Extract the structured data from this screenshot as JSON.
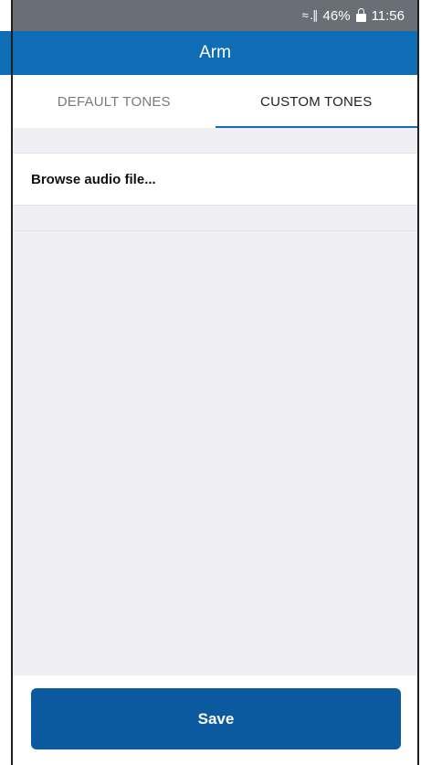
{
  "status_bar": {
    "signal_icons": "≈ .∥",
    "battery": "46%",
    "time": "11:56"
  },
  "app_bar": {
    "title": "Arm"
  },
  "tabs": [
    {
      "label": "DEFAULT TONES",
      "active": false
    },
    {
      "label": "CUSTOM TONES",
      "active": true
    }
  ],
  "list": {
    "browse_label": "Browse audio file..."
  },
  "footer": {
    "save_label": "Save"
  },
  "colors": {
    "accent": "#0f6db5",
    "button": "#0b5aa0",
    "background": "#f0eff4"
  }
}
